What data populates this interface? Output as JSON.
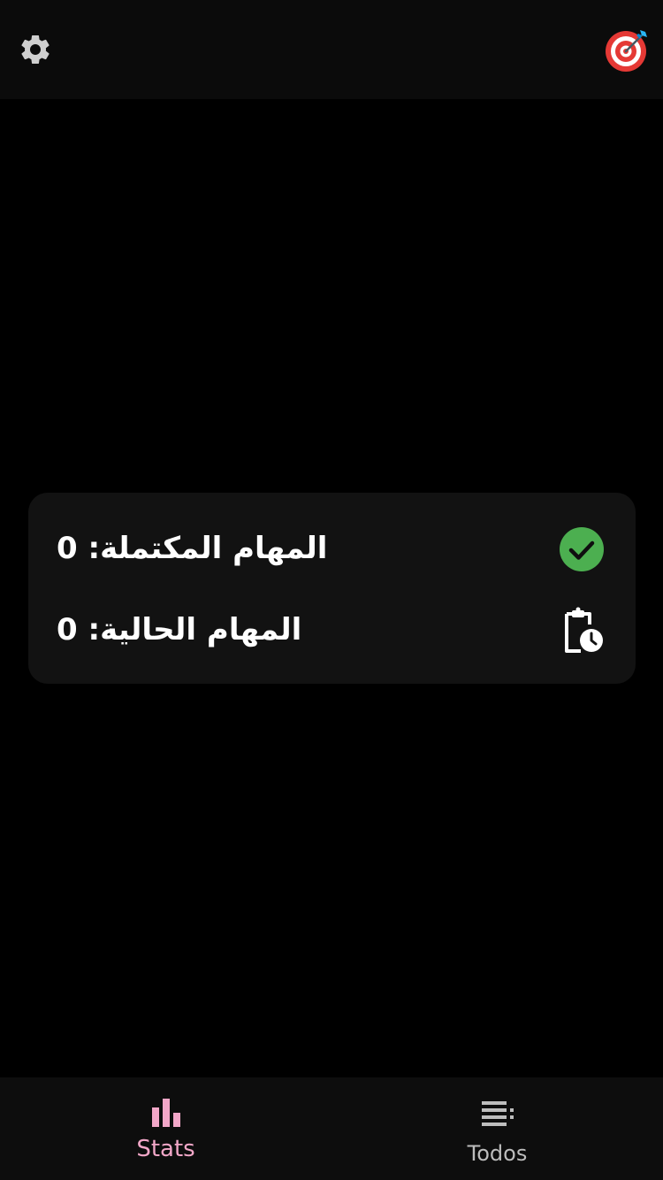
{
  "header": {
    "settings_icon": "gear-icon",
    "logo_icon": "target-dart-icon"
  },
  "stats": {
    "completed": {
      "label": "المهام المكتملة: 0",
      "icon": "check-circle-icon",
      "icon_color": "#4caf50"
    },
    "current": {
      "label": "المهام الحالية: 0",
      "icon": "clipboard-clock-icon"
    }
  },
  "bottom_nav": {
    "active_color": "#f2a7c8",
    "inactive_color": "#bdbdbd",
    "items": [
      {
        "label": "Stats",
        "icon": "bar-chart-icon",
        "active": true
      },
      {
        "label": "Todos",
        "icon": "list-icon",
        "active": false
      }
    ]
  }
}
